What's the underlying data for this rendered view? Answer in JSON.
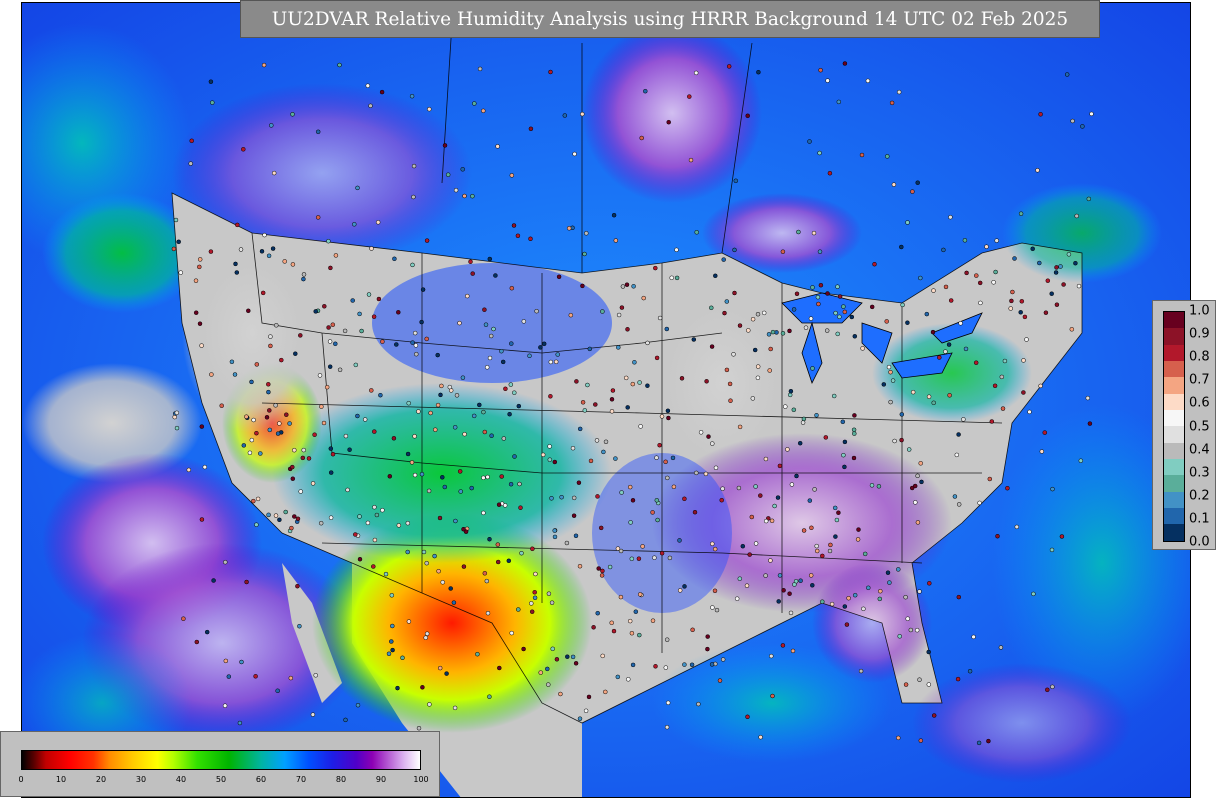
{
  "title": "UU2DVAR Relative Humidity Analysis using HRRR Background 14 UTC 02 Feb 2025",
  "rh_colorbar": {
    "ticks": [
      "0",
      "10",
      "20",
      "30",
      "40",
      "50",
      "60",
      "70",
      "80",
      "90",
      "100"
    ]
  },
  "ratio_colorbar": {
    "ticks": [
      "1.0",
      "0.9",
      "0.8",
      "0.7",
      "0.6",
      "0.5",
      "0.4",
      "0.3",
      "0.2",
      "0.1",
      "0.0"
    ],
    "colors": [
      "#67001f",
      "#8c1227",
      "#b2182b",
      "#d6604d",
      "#f4a582",
      "#fddbc7",
      "#f7f7f7",
      "#e0e0e0",
      "#bababa",
      "#80cdc1",
      "#5aae9a",
      "#4292c6",
      "#2166ac",
      "#053061"
    ]
  },
  "colors": {
    "ocean_blue": "#1e6eff",
    "land_gray": "#c8c8c8",
    "panel_gray": "#c0c0c0",
    "title_bg": "#8a8a8a"
  }
}
